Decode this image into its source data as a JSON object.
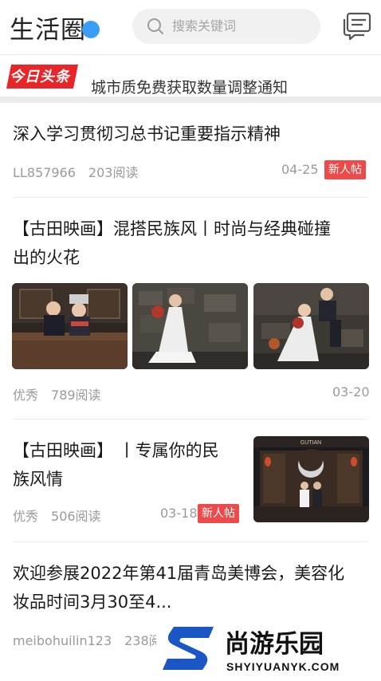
{
  "header": {
    "title": "生活圈",
    "search_placeholder": "搜索关键词"
  },
  "ticker": {
    "logo_text": "今日头条",
    "headline": "城市质免费获取数量调整通知"
  },
  "posts": [
    {
      "title": "深入学习贯彻习总书记重要指示精神",
      "author": "LL857966",
      "views": "203阅读",
      "date": "04-25",
      "badge": "新人帖"
    },
    {
      "title_line1": "【古田映画】混搭民族风丨时尚与经典碰撞",
      "title_line2": "出的火花",
      "author": "优秀",
      "views": "789阅读",
      "date": "03-20"
    },
    {
      "title_line1": "【古田映画】 丨专属你的民",
      "title_line2": "族风情",
      "author": "优秀",
      "views": "506阅读",
      "date": "03-18",
      "badge": "新人帖",
      "thumb_sign": "GUTIAN"
    },
    {
      "title_line1": "欢迎参展2022年第41届青岛美博会，美容化",
      "title_line2": "妆品时间3月30至4...",
      "author": "meibohuilin123",
      "views": "238阅"
    }
  ],
  "watermark": {
    "brand": "尚游乐园",
    "url": "SHYIYUANYK.COM"
  },
  "colors": {
    "accent_blue": "#3a9ef7",
    "badge_red": "#ef4a4a",
    "toutiao_red": "#e8262a"
  }
}
